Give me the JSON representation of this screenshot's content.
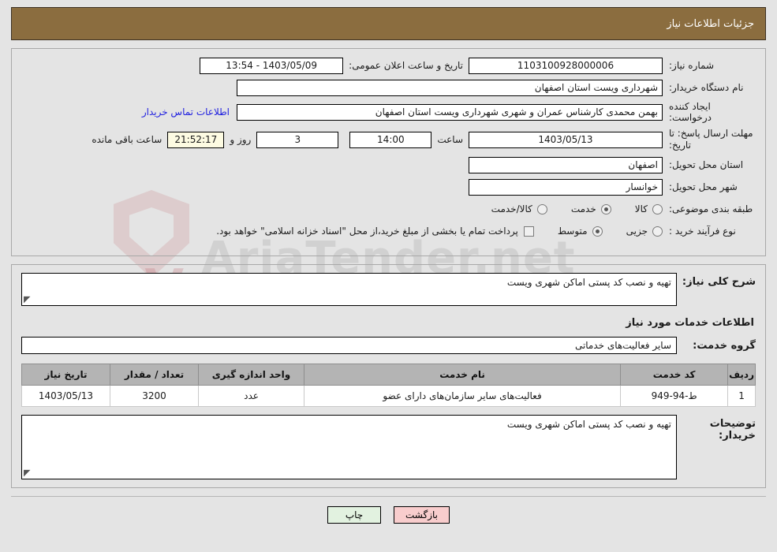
{
  "header": {
    "title": "جزئیات اطلاعات نیاز"
  },
  "watermark": {
    "text": "AriaTender.net"
  },
  "top": {
    "need_number_label": "شماره نیاز:",
    "need_number_value": "1103100928000006",
    "publish_label": "تاریخ و ساعت اعلان عمومی:",
    "publish_value": "1403/05/09 - 13:54",
    "buyer_org_label": "نام دستگاه خریدار:",
    "buyer_org_value": "شهرداری ویست استان اصفهان",
    "creator_label": "ایجاد کننده درخواست:",
    "creator_value": "بهمن محمدی کارشناس عمران و شهری شهرداری ویست استان اصفهان",
    "contact_link": "اطلاعات تماس خریدار",
    "deadline_label": "مهلت ارسال پاسخ: تا تاریخ:",
    "deadline_date": "1403/05/13",
    "hour_label": "ساعت",
    "deadline_time": "14:00",
    "days_value": "3",
    "days_label": "روز و",
    "countdown_value": "21:52:17",
    "remaining_label": "ساعت باقی مانده",
    "province_label": "استان محل تحویل:",
    "province_value": "اصفهان",
    "city_label": "شهر محل تحویل:",
    "city_value": "خوانسار",
    "category_label": "طبقه بندی موضوعی:",
    "category_options": [
      {
        "label": "کالا",
        "checked": false
      },
      {
        "label": "خدمت",
        "checked": true
      },
      {
        "label": "کالا/خدمت",
        "checked": false
      }
    ],
    "process_label": "نوع فرآیند خرید :",
    "process_options": [
      {
        "label": "جزیی",
        "checked": false
      },
      {
        "label": "متوسط",
        "checked": true
      }
    ],
    "treasury_checked": false,
    "treasury_note": "پرداخت تمام یا بخشی از مبلغ خرید،از محل \"اسناد خزانه اسلامی\" خواهد بود."
  },
  "middle": {
    "summary_label": "شرح کلی نیاز:",
    "summary_value": "تهیه و نصب کد پستی اماکن شهری ویست",
    "services_head": "اطلاعات خدمات مورد نیاز",
    "service_group_label": "گروه خدمت:",
    "service_group_value": "سایر فعالیت‌های خدماتی",
    "table": {
      "columns": [
        "ردیف",
        "کد خدمت",
        "نام خدمت",
        "واحد اندازه گیری",
        "تعداد / مقدار",
        "تاریخ نیاز"
      ],
      "rows": [
        {
          "radif": "1",
          "code": "ط-94-949",
          "name": "فعالیت‌های سایر سازمان‌های دارای عضو",
          "unit": "عدد",
          "qty": "3200",
          "date": "1403/05/13"
        }
      ]
    },
    "comments_label": "توضیحات خریدار:",
    "comments_value": "تهیه و نصب کد پستی اماکن شهری ویست"
  },
  "footer": {
    "print_label": "چاپ",
    "back_label": "بازگشت"
  }
}
